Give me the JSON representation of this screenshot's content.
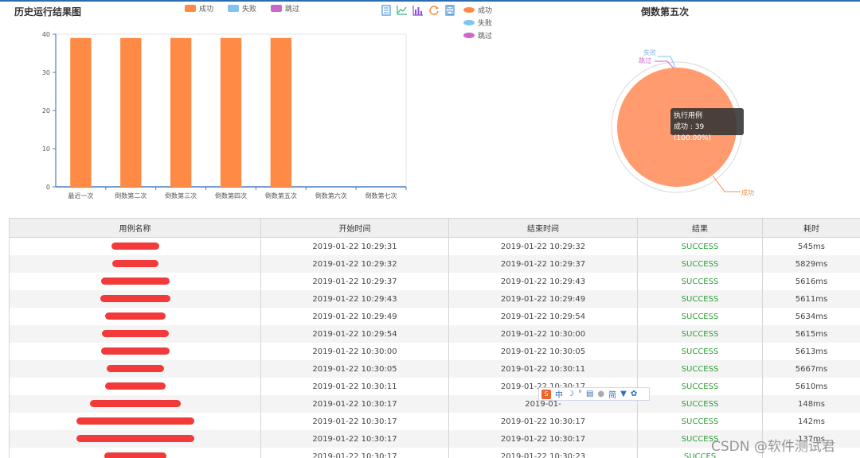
{
  "colors": {
    "success": "#ff8a45",
    "fail": "#7fc3ef",
    "skip": "#cc66cc",
    "pie_success": "#ff9b6e",
    "result_text": "#2f9e3a"
  },
  "bar_panel": {
    "title": "历史运行结果图",
    "legend": [
      "成功",
      "失败",
      "跳过"
    ],
    "toolbox_icons": [
      "data-view-icon",
      "line-chart-icon",
      "bar-chart-icon",
      "refresh-icon",
      "save-icon"
    ]
  },
  "pie_panel": {
    "title": "倒数第五次",
    "legend": [
      "成功",
      "失败",
      "跳过"
    ],
    "tooltip": {
      "title": "执行用例",
      "text": "成功 : 39 (100.00%)"
    },
    "labels": {
      "fail": "失败",
      "skip": "跳过",
      "success": "成功"
    }
  },
  "chart_data": [
    {
      "type": "bar",
      "categories": [
        "最近一次",
        "倒数第二次",
        "倒数第三次",
        "倒数第四次",
        "倒数第五次",
        "倒数第六次",
        "倒数第七次"
      ],
      "series": [
        {
          "name": "成功",
          "values": [
            39,
            39,
            39,
            39,
            39,
            0,
            0
          ]
        },
        {
          "name": "失败",
          "values": [
            0,
            0,
            0,
            0,
            0,
            0,
            0
          ]
        },
        {
          "name": "跳过",
          "values": [
            0,
            0,
            0,
            0,
            0,
            0,
            0
          ]
        }
      ],
      "title": "历史运行结果图",
      "ylim": [
        0,
        40
      ],
      "yticks": [
        0,
        10,
        20,
        30,
        40
      ],
      "legend_placement": "top",
      "grid": false
    },
    {
      "type": "pie",
      "categories": [
        "成功",
        "失败",
        "跳过"
      ],
      "values": [
        39,
        0,
        0
      ],
      "title": "倒数第五次",
      "legend_placement": "top-left"
    }
  ],
  "table": {
    "headers": [
      "用例名称",
      "开始时间",
      "结束时间",
      "结果",
      "耗时"
    ],
    "rows": [
      {
        "start": "2019-01-22 10:29:31",
        "end": "2019-01-22 10:29:32",
        "result": "SUCCESS",
        "duration": "545ms"
      },
      {
        "start": "2019-01-22 10:29:32",
        "end": "2019-01-22 10:29:37",
        "result": "SUCCESS",
        "duration": "5829ms"
      },
      {
        "start": "2019-01-22 10:29:37",
        "end": "2019-01-22 10:29:43",
        "result": "SUCCESS",
        "duration": "5616ms"
      },
      {
        "start": "2019-01-22 10:29:43",
        "end": "2019-01-22 10:29:49",
        "result": "SUCCESS",
        "duration": "5611ms"
      },
      {
        "start": "2019-01-22 10:29:49",
        "end": "2019-01-22 10:29:54",
        "result": "SUCCESS",
        "duration": "5634ms"
      },
      {
        "start": "2019-01-22 10:29:54",
        "end": "2019-01-22 10:30:00",
        "result": "SUCCESS",
        "duration": "5615ms"
      },
      {
        "start": "2019-01-22 10:30:00",
        "end": "2019-01-22 10:30:05",
        "result": "SUCCESS",
        "duration": "5613ms"
      },
      {
        "start": "2019-01-22 10:30:05",
        "end": "2019-01-22 10:30:11",
        "result": "SUCCESS",
        "duration": "5667ms"
      },
      {
        "start": "2019-01-22 10:30:11",
        "end": "2019-01-22 10:30:17",
        "result": "SUCCESS",
        "duration": "5610ms"
      },
      {
        "start": "2019-01-22 10:30:17",
        "end": "2019-01-",
        "result": "SUCCESS",
        "duration": "148ms"
      },
      {
        "start": "2019-01-22 10:30:17",
        "end": "2019-01-22 10:30:17",
        "result": "SUCCESS",
        "duration": "142ms"
      },
      {
        "start": "2019-01-22 10:30:17",
        "end": "2019-01-22 10:30:17",
        "result": "SUCCESS",
        "duration": "137ms"
      },
      {
        "start": "2019-01-22 10:30:17",
        "end": "2019-01-22 10:30:23",
        "result": "SUCCES",
        "duration": ""
      }
    ]
  },
  "ime_toolbar": {
    "chinese_mode": "中",
    "simplified": "简",
    "icons": [
      "sogou-logo-icon",
      "moon-icon",
      "punctuation-icon",
      "keyboard-icon",
      "user-icon",
      "shirt-icon",
      "gear-icon"
    ]
  },
  "watermark": "CSDN @软件测试君"
}
